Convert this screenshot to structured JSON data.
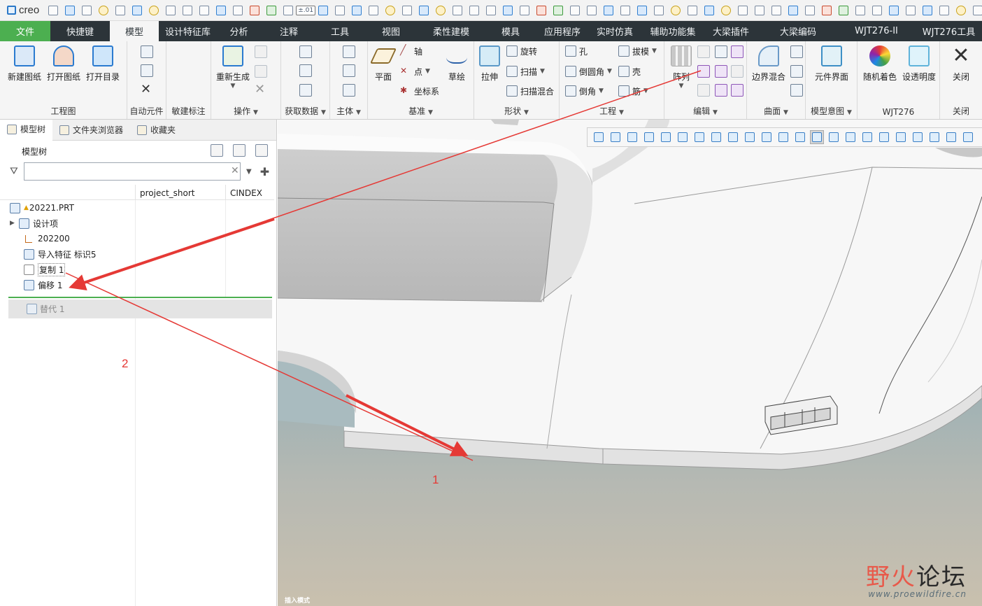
{
  "app": {
    "logo": "creo"
  },
  "qat": {
    "value_display": "±.01"
  },
  "tabs": [
    "文件",
    "快捷键",
    "模型",
    "设计特征库",
    "分析",
    "注释",
    "工具",
    "视图",
    "柔性建模",
    "模具",
    "应用程序",
    "实时仿真",
    "辅助功能集",
    "大梁插件",
    "大梁编码",
    "WJT276-II",
    "WJT276工具"
  ],
  "ribbon": {
    "groups": {
      "engineering_drawing": {
        "label": "工程图",
        "buttons": [
          "新建图纸",
          "打开图纸",
          "打开目录"
        ]
      },
      "auto_component": {
        "label": "自动元件"
      },
      "sensitive_annotation": {
        "label": "敏建标注"
      },
      "operations": {
        "label": "操作",
        "regenerate": "重新生成"
      },
      "get_data": {
        "label": "获取数据"
      },
      "body": {
        "label": "主体"
      },
      "datum": {
        "label": "基准",
        "plane": "平面",
        "axis": "轴",
        "point": "点",
        "csys": "坐标系",
        "sketch": "草绘"
      },
      "shapes": {
        "label": "形状",
        "extrude": "拉伸",
        "revolve": "旋转",
        "sweep": "扫描",
        "swept_blend": "扫描混合"
      },
      "engineering": {
        "label": "工程",
        "hole": "孔",
        "round": "倒圆角",
        "chamfer": "倒角",
        "draft": "拔模",
        "shell": "壳",
        "rib": "筋"
      },
      "editing": {
        "label": "编辑",
        "pattern": "阵列"
      },
      "surfaces": {
        "label": "曲面",
        "boundary_blend": "边界混合"
      },
      "model_intent": {
        "label": "模型意图",
        "component_interface": "元件界面"
      },
      "wjt276": {
        "label": "WJT276",
        "random_color": "随机着色",
        "transparency": "设透明度"
      },
      "close": {
        "label": "关闭",
        "close_btn": "关闭"
      }
    }
  },
  "panel": {
    "tabs": [
      "模型树",
      "文件夹浏览器",
      "收藏夹"
    ],
    "title": "模型树",
    "filter_placeholder": "",
    "columns": [
      "project_short",
      "CINDEX"
    ],
    "tree": [
      {
        "label": "20221.PRT"
      },
      {
        "label": "设计项"
      },
      {
        "label": "202200"
      },
      {
        "label": "导入特征 标识5"
      },
      {
        "label": "复制 1"
      },
      {
        "label": "偏移 1"
      }
    ],
    "replace_node": "替代 1"
  },
  "annotations": {
    "marker1": "1",
    "marker2": "2",
    "arrow_color": "#e53935"
  },
  "viewport": {
    "mode": "插入模式"
  },
  "watermark": {
    "part1": "野火",
    "part2": "论坛",
    "url": "www.proewildfire.cn"
  },
  "colors": {
    "tab_bar": "#2c3439",
    "file_tab": "#4caf50",
    "insert_line": "#4caf50"
  }
}
